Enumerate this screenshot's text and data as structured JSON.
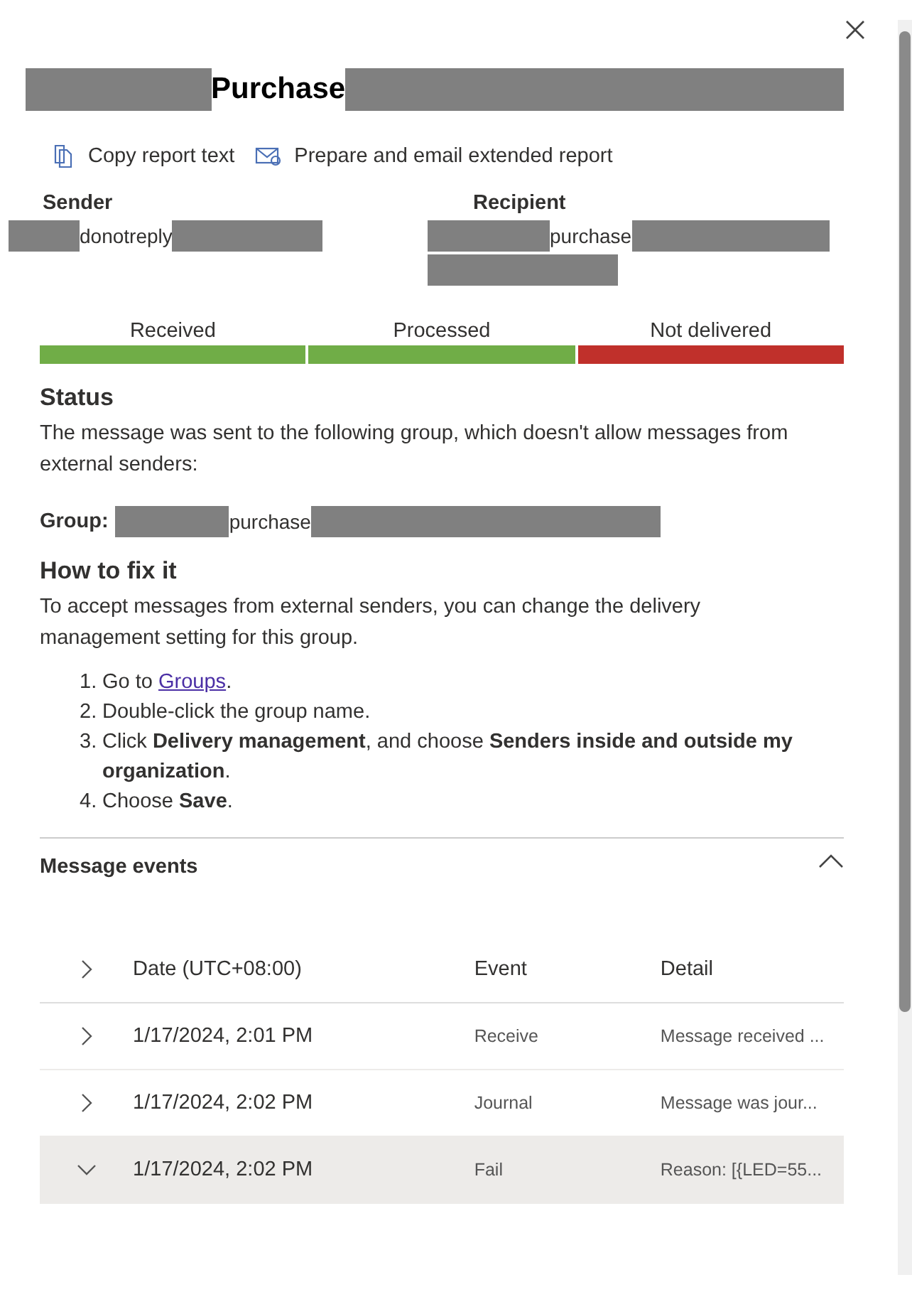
{
  "title": [
    {
      "kind": "redacted"
    },
    {
      "kind": "text",
      "text": "Purchase"
    },
    {
      "kind": "redacted"
    }
  ],
  "actions": [
    {
      "kind": "copy",
      "label": "Copy report text"
    },
    {
      "kind": "email",
      "label": "Prepare and email extended report"
    }
  ],
  "sender": {
    "label": "Sender",
    "value": [
      {
        "kind": "redacted"
      },
      {
        "kind": "text",
        "text": "donotreply"
      },
      {
        "kind": "redacted"
      }
    ]
  },
  "recipient": {
    "label": "Recipient",
    "value": [
      {
        "kind": "redacted"
      },
      {
        "kind": "text",
        "text": "purchase"
      },
      {
        "kind": "redacted"
      },
      {
        "kind": "redacted"
      }
    ]
  },
  "stages": [
    {
      "label": "Received",
      "color": "#70ad47"
    },
    {
      "label": "Processed",
      "color": "#70ad47"
    },
    {
      "label": "Not delivered",
      "color": "#c0302b"
    }
  ],
  "status": {
    "heading": "Status",
    "text": "The message was sent to the following group, which doesn't allow messages from external senders:",
    "group_label": "Group:",
    "group": [
      {
        "kind": "redacted"
      },
      {
        "kind": "text",
        "text": "purchase"
      },
      {
        "kind": "redacted"
      }
    ]
  },
  "fix": {
    "heading": "How to fix it",
    "text": "To accept messages from external senders, you can change the delivery management setting for this group.",
    "steps": [
      {
        "kind": "link",
        "number": "1.",
        "before": "Go to ",
        "link": "Groups",
        "after": "."
      },
      {
        "kind": "text",
        "number": "2.",
        "text": "Double-click the group name."
      },
      {
        "kind": "text",
        "number": "3.",
        "text": "Click **Delivery management**, and choose **Senders inside and outside my organization**."
      },
      {
        "kind": "text",
        "number": "4.",
        "text": "Choose **Save**."
      }
    ]
  },
  "events": {
    "heading": "Message events",
    "expanded": true,
    "columns": [
      "Date (UTC+08:00)",
      "Event",
      "Detail"
    ],
    "rows": [
      {
        "date": "1/17/2024, 2:01 PM",
        "event": "Receive",
        "detail": "Message received ...",
        "selected": false,
        "expanded": false
      },
      {
        "date": "1/17/2024, 2:02 PM",
        "event": "Journal",
        "detail": "Message was jour...",
        "selected": false,
        "expanded": false
      },
      {
        "date": "1/17/2024, 2:02 PM",
        "event": "Fail",
        "detail": "Reason: [{LED=55...",
        "selected": true,
        "expanded": true
      }
    ]
  }
}
